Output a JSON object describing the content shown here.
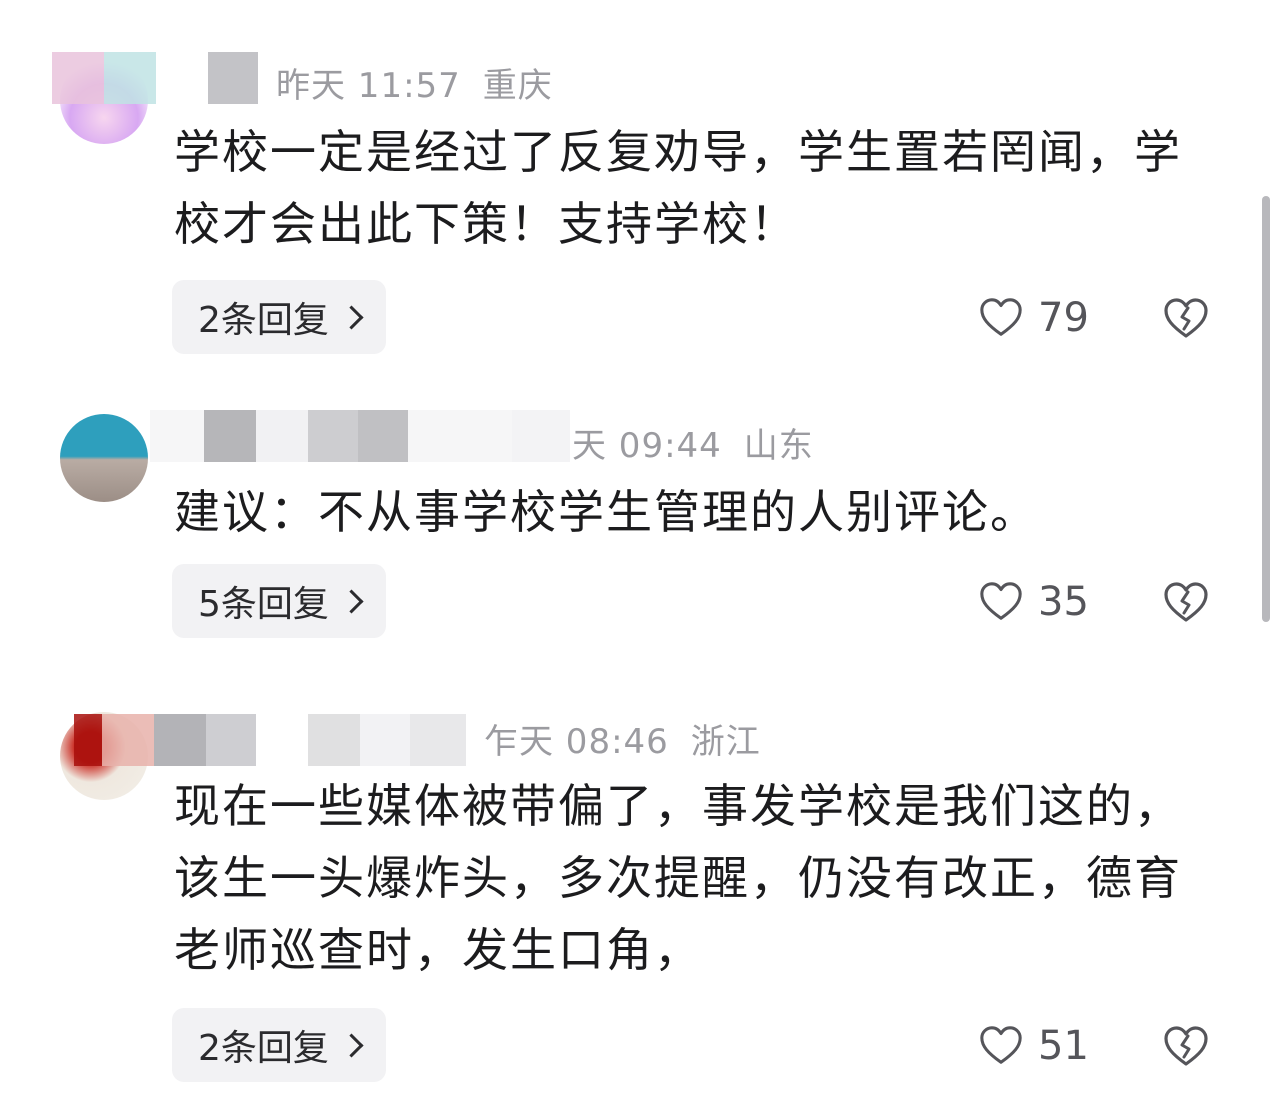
{
  "comments": [
    {
      "time": "昨天 11:57",
      "location": "重庆",
      "text": "学校一定是经过了反复劝导，学生置若罔闻，学校才会出此下策！支持学校！",
      "reply_label": "2条回复",
      "likes": "79"
    },
    {
      "time": "天 09:44",
      "location": "山东",
      "text": "建议：不从事学校学生管理的人别评论。",
      "reply_label": "5条回复",
      "likes": "35"
    },
    {
      "time": "乍天 08:46",
      "location": "浙江",
      "text": "现在一些媒体被带偏了，事发学校是我们这的，该生一头爆炸头，多次提醒，仍没有改正，德育老师巡查时，发生口角，",
      "reply_label": "2条回复",
      "likes": "51"
    }
  ],
  "icons": {
    "like": "heart-outline-icon",
    "dislike": "broken-heart-icon",
    "reply_more": "chevron-right-icon"
  },
  "colors": {
    "meta_text": "#9b9ba0",
    "body_text": "#1c1c1e",
    "reply_bg": "#f2f2f4"
  }
}
